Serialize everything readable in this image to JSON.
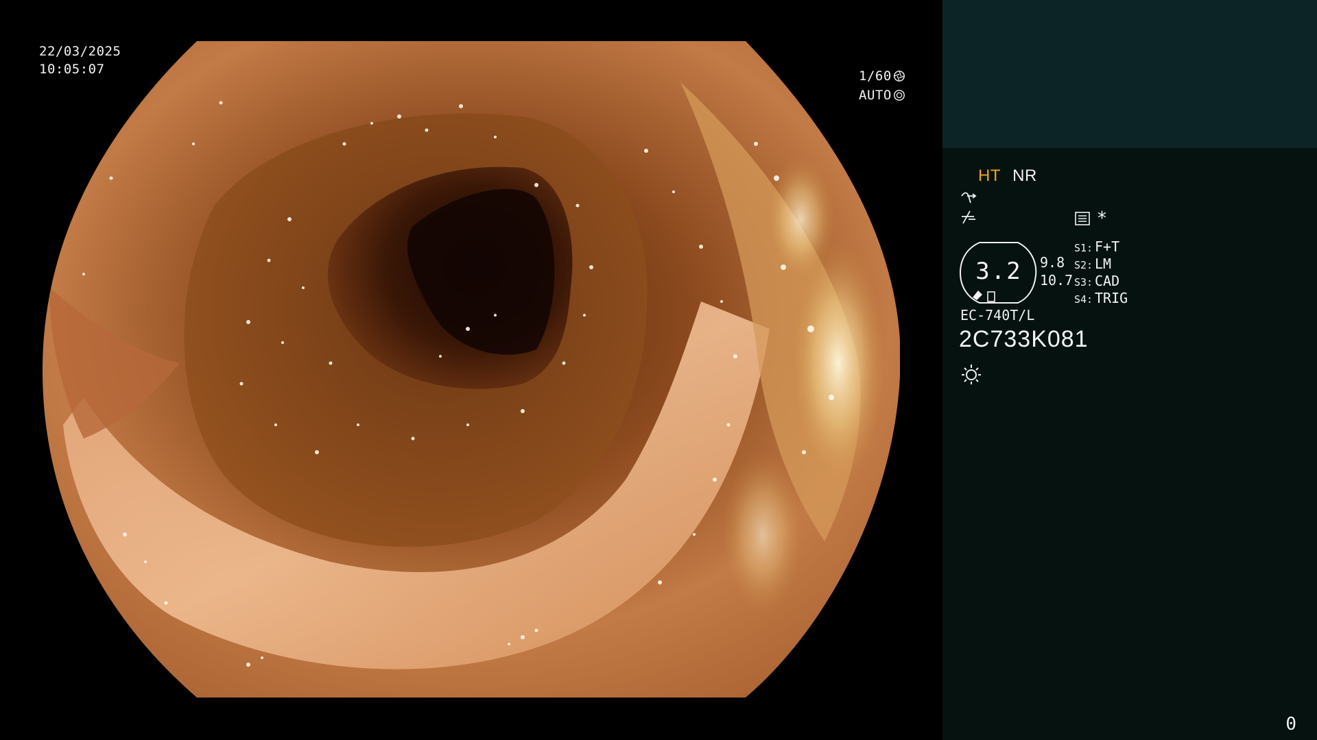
{
  "overlay": {
    "date": "22/03/2025",
    "time": "10:05:07",
    "shutter": "1/60",
    "shutter_icon": "aperture-icon",
    "exposure_mode": "AUTO",
    "exposure_icon": "iris-icon"
  },
  "panel": {
    "mode_ht": "HT",
    "mode_nr": "NR",
    "asterisk": "*",
    "zoom_value": "3.2",
    "zoom_sub_1": "9.8",
    "zoom_sub_2": "10.7",
    "switches": [
      {
        "key": "S1:",
        "value": "F+T"
      },
      {
        "key": "S2:",
        "value": "LM"
      },
      {
        "key": "S3:",
        "value": "CAD"
      },
      {
        "key": "S4:",
        "value": "TRIG"
      }
    ],
    "model": "EC-740T/L",
    "serial": "2C733K081",
    "counter": "0",
    "icons": [
      "curve-icon",
      "slash-icon",
      "list-icon",
      "brightness-icon",
      "zoom-badge-icon"
    ]
  },
  "colors": {
    "background": "#000000",
    "panel_top": "#0d2426",
    "panel_bottom": "#051210",
    "ht_accent": "#f2a21e",
    "text": "#f2f2f2"
  }
}
